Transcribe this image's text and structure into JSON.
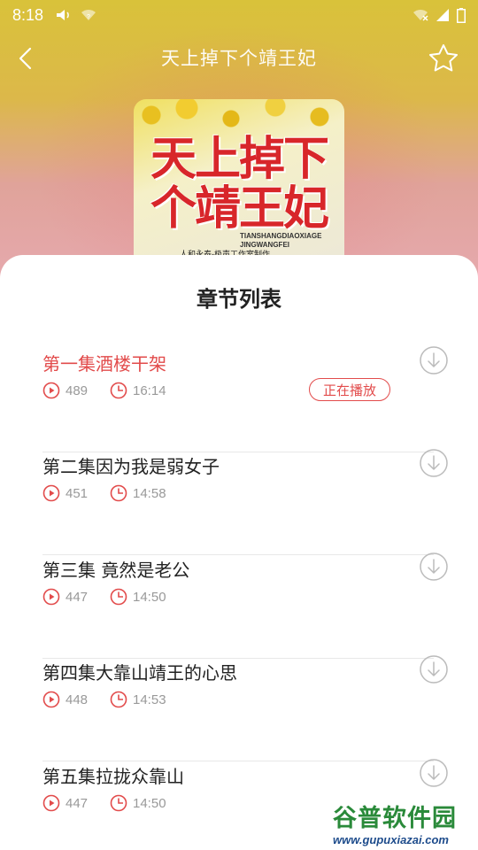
{
  "status_bar": {
    "time": "8:18",
    "icons": [
      "volume-icon",
      "wifi-question-icon",
      "wifi-off-icon",
      "signal-icon",
      "battery-icon"
    ]
  },
  "header": {
    "title": "天上掉下个靖王妃",
    "back_icon": "chevron-left-icon",
    "favorite_icon": "star-outline-icon"
  },
  "cover": {
    "title_line1": "天上掉下",
    "title_line2": "个靖王妃",
    "pinyin_line1": "TIANSHANGDIAOXIAGE",
    "pinyin_line2": "JINGWANGFEI",
    "credit": "人和永泰-极声工作室制作"
  },
  "sheet": {
    "title": "章节列表"
  },
  "chapters": [
    {
      "title": "第一集酒楼干架",
      "plays": "489",
      "duration": "16:14",
      "active": true,
      "badge": "正在播放"
    },
    {
      "title": "第二集因为我是弱女子",
      "plays": "451",
      "duration": "14:58",
      "active": false
    },
    {
      "title": "第三集 竟然是老公",
      "plays": "447",
      "duration": "14:50",
      "active": false
    },
    {
      "title": "第四集大靠山靖王的心思",
      "plays": "448",
      "duration": "14:53",
      "active": false
    },
    {
      "title": "第五集拉拢众靠山",
      "plays": "447",
      "duration": "14:50",
      "active": false
    }
  ],
  "watermark": {
    "name": "谷普软件园",
    "url": "www.gupuxiazai.com"
  },
  "colors": {
    "accent": "#e24b4b",
    "text": "#222222",
    "meta": "#999999",
    "header_bg": "#d9c23a"
  }
}
